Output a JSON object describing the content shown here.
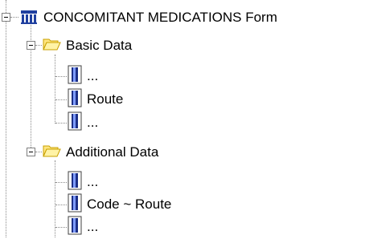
{
  "tree": {
    "root": {
      "label": "CONCOMITANT MEDICATIONS Form",
      "icon": "form-table-icon",
      "expanded": true
    },
    "groups": [
      {
        "label": "Basic Data",
        "icon": "folder-open-icon",
        "expanded": true,
        "items": [
          {
            "label": "...",
            "icon": "field-icon"
          },
          {
            "label": "Route",
            "icon": "field-icon"
          },
          {
            "label": "...",
            "icon": "field-icon"
          }
        ]
      },
      {
        "label": "Additional Data",
        "icon": "folder-open-icon",
        "expanded": true,
        "items": [
          {
            "label": "...",
            "icon": "field-icon"
          },
          {
            "label": "Code ~ Route",
            "icon": "field-icon"
          },
          {
            "label": "...",
            "icon": "field-icon"
          }
        ]
      }
    ]
  },
  "colors": {
    "background": "#ffffff",
    "tree_lines": "#8a8a8a",
    "folder_fill": "#fff3a6",
    "folder_stroke": "#c8a000",
    "form_icon_blue": "#1f3f9f",
    "field_icon_blue": "#1c2f86"
  }
}
